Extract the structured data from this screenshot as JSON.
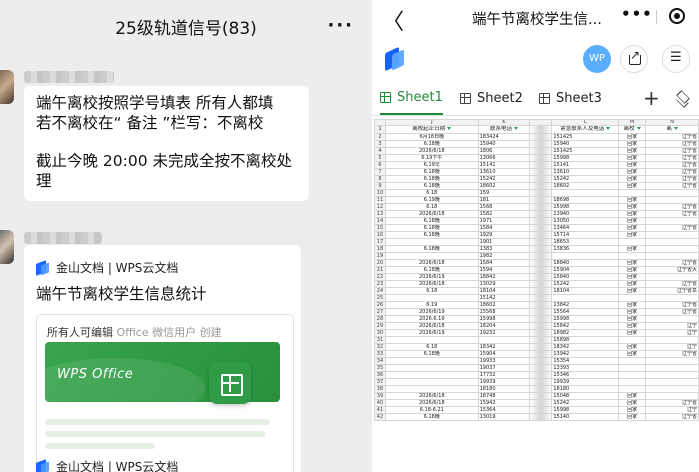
{
  "chat": {
    "title": "25级轨道信号(83)",
    "more_label": "···",
    "message_text": "端午离校按照学号填表 所有人都填  若不离校在“ 备注 ”栏写：不离校",
    "message_deadline": "截止今晚 20:00 未完成全按不离校处理",
    "card": {
      "source_label": "金山文档 | WPS云文档",
      "title": "端午节离校学生信息统计",
      "perm_label": "所有人可编辑",
      "perm_meta": "Office  微信用户  创建",
      "banner_label": "WPS Office",
      "icon": "sheet-tile-icon"
    },
    "card2_source_label": "金山文档 | WPS云文档"
  },
  "sheet_view": {
    "back_label": "〈",
    "title": "端午节离校学生信...",
    "dots_label": "•••",
    "avatar_label": "WP",
    "tabs": [
      {
        "label": "Sheet1",
        "active": true
      },
      {
        "label": "Sheet2",
        "active": false
      },
      {
        "label": "Sheet3",
        "active": false
      }
    ],
    "add_label": "+",
    "accent_color": "#1f8c3a",
    "column_letters": [
      "J",
      "K",
      "L",
      "M",
      "N"
    ],
    "field_headers": [
      "离校起止日期",
      "联系电话",
      "紧急联系人及电话",
      "离校",
      "离"
    ],
    "rows": [
      {
        "n": "1",
        "date": "",
        "phone": "",
        "emerg": "",
        "leave": "",
        "addr": ""
      },
      {
        "n": "2",
        "date": "6月18日晚",
        "phone": "183424",
        "emerg": "151425",
        "leave": "回家",
        "addr": "辽宁省"
      },
      {
        "n": "3",
        "date": "6.18晚",
        "phone": "15940",
        "emerg": "15940",
        "leave": "回家",
        "addr": "辽宁省"
      },
      {
        "n": "4",
        "date": "2026/6/18",
        "phone": "1806",
        "emerg": "151425",
        "leave": "回家",
        "addr": "辽宁省"
      },
      {
        "n": "5",
        "date": "6.19下午",
        "phone": "13066",
        "emerg": "15998",
        "leave": "回家",
        "addr": "辽宁省"
      },
      {
        "n": "6",
        "date": "6.19早",
        "phone": "15141",
        "emerg": "15141",
        "leave": "回家",
        "addr": "辽宁省"
      },
      {
        "n": "7",
        "date": "6.18晚",
        "phone": "13610",
        "emerg": "13610",
        "leave": "回家",
        "addr": "辽宁省"
      },
      {
        "n": "8",
        "date": "6.18晚",
        "phone": "15242",
        "emerg": "15242",
        "leave": "回家",
        "addr": "辽宁省"
      },
      {
        "n": "9",
        "date": "6.18晚",
        "phone": "18602",
        "emerg": "18602",
        "leave": "回家",
        "addr": "辽宁省"
      },
      {
        "n": "10",
        "date": "6.18",
        "phone": "159",
        "emerg": "",
        "leave": "",
        "addr": ""
      },
      {
        "n": "11",
        "date": "6.19晚",
        "phone": "181",
        "emerg": "18698",
        "leave": "回家",
        "addr": ""
      },
      {
        "n": "12",
        "date": "6.18",
        "phone": "1568",
        "emerg": "15998",
        "leave": "回家",
        "addr": "辽宁省"
      },
      {
        "n": "13",
        "date": "2026/6/18",
        "phone": "1582",
        "emerg": "13940",
        "leave": "回家",
        "addr": "辽宁省"
      },
      {
        "n": "14",
        "date": "6.18晚",
        "phone": "1971",
        "emerg": "13050",
        "leave": "回家",
        "addr": ""
      },
      {
        "n": "15",
        "date": "6.18晚",
        "phone": "1584",
        "emerg": "13464",
        "leave": "回家",
        "addr": "辽宁省"
      },
      {
        "n": "16",
        "date": "6.18晚",
        "phone": "1929",
        "emerg": "15714",
        "leave": "回家",
        "addr": ""
      },
      {
        "n": "17",
        "date": "",
        "phone": "1901",
        "emerg": "18653",
        "leave": "",
        "addr": ""
      },
      {
        "n": "18",
        "date": "6.18晚",
        "phone": "1383",
        "emerg": "13836",
        "leave": "回家",
        "addr": ""
      },
      {
        "n": "19",
        "date": "",
        "phone": "1982",
        "emerg": "",
        "leave": "",
        "addr": ""
      },
      {
        "n": "20",
        "date": "2026/6/18",
        "phone": "1584",
        "emerg": "18840",
        "leave": "回家",
        "addr": "辽宁省"
      },
      {
        "n": "21",
        "date": "6.18晚",
        "phone": "1594",
        "emerg": "15904",
        "leave": "回家",
        "addr": "辽宁省大"
      },
      {
        "n": "22",
        "date": "2026/6/19",
        "phone": "18842",
        "emerg": "15840",
        "leave": "回家",
        "addr": ""
      },
      {
        "n": "23",
        "date": "2026/6/18",
        "phone": "13029",
        "emerg": "15242",
        "leave": "回家",
        "addr": "辽宁省"
      },
      {
        "n": "24",
        "date": "6.18",
        "phone": "18104",
        "emerg": "18104",
        "leave": "回家",
        "addr": "辽宁省阜"
      },
      {
        "n": "25",
        "date": "",
        "phone": "15142",
        "emerg": "",
        "leave": "",
        "addr": ""
      },
      {
        "n": "26",
        "date": "6.19",
        "phone": "18602",
        "emerg": "13842",
        "leave": "回家",
        "addr": "辽宁省"
      },
      {
        "n": "27",
        "date": "2026/6/19",
        "phone": "15568",
        "emerg": "15564",
        "leave": "回家",
        "addr": "辽宁省"
      },
      {
        "n": "28",
        "date": "2026.6.19",
        "phone": "15998",
        "emerg": "15998",
        "leave": "回家",
        "addr": ""
      },
      {
        "n": "29",
        "date": "2026/6/18",
        "phone": "18204",
        "emerg": "15842",
        "leave": "回家",
        "addr": "辽宁"
      },
      {
        "n": "30",
        "date": "2026/6/19",
        "phone": "19232",
        "emerg": "18982",
        "leave": "回家",
        "addr": "辽宁"
      },
      {
        "n": "31",
        "date": "",
        "phone": "",
        "emerg": "15898",
        "leave": "",
        "addr": ""
      },
      {
        "n": "32",
        "date": "6.18",
        "phone": "18342",
        "emerg": "18342",
        "leave": "回家",
        "addr": "辽宁"
      },
      {
        "n": "33",
        "date": "6.18晚",
        "phone": "15904",
        "emerg": "13942",
        "leave": "回家",
        "addr": "辽宁省"
      },
      {
        "n": "34",
        "date": "",
        "phone": "19933",
        "emerg": "15354",
        "leave": "",
        "addr": ""
      },
      {
        "n": "35",
        "date": "",
        "phone": "19037",
        "emerg": "13393",
        "leave": "",
        "addr": ""
      },
      {
        "n": "36",
        "date": "",
        "phone": "17732",
        "emerg": "15346",
        "leave": "",
        "addr": ""
      },
      {
        "n": "37",
        "date": "",
        "phone": "19939",
        "emerg": "19939",
        "leave": "",
        "addr": ""
      },
      {
        "n": "38",
        "date": "",
        "phone": "18180",
        "emerg": "18180",
        "leave": "",
        "addr": ""
      },
      {
        "n": "39",
        "date": "2026/6/18",
        "phone": "18748",
        "emerg": "15048",
        "leave": "回家",
        "addr": ""
      },
      {
        "n": "40",
        "date": "2026/6/18",
        "phone": "15942",
        "emerg": "15242",
        "leave": "回家",
        "addr": "辽宁省"
      },
      {
        "n": "41",
        "date": "6.18-6.21",
        "phone": "15364",
        "emerg": "15998",
        "leave": "回家",
        "addr": "辽宁"
      },
      {
        "n": "42",
        "date": "6.18晚",
        "phone": "13019",
        "emerg": "15140",
        "leave": "回家",
        "addr": "辽宁省"
      }
    ]
  }
}
